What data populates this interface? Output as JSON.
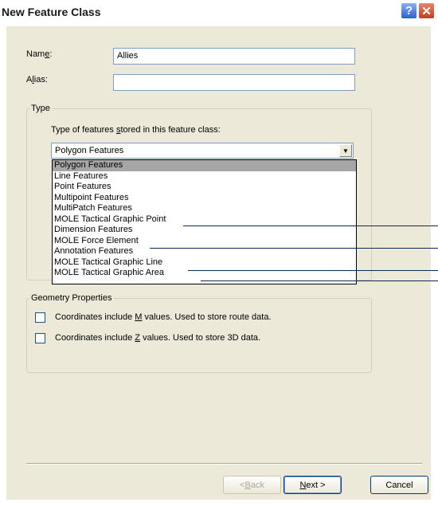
{
  "window": {
    "title": "New Feature Class"
  },
  "form": {
    "name_label_prefix": "Nam",
    "name_label_accel": "e",
    "name_label_suffix": ":",
    "name_value": "Allies",
    "alias_label_prefix": "A",
    "alias_label_accel": "l",
    "alias_label_suffix": "ias:",
    "alias_value": ""
  },
  "type_group": {
    "legend": "Type",
    "prompt_prefix": "Type of features ",
    "prompt_accel": "s",
    "prompt_suffix": "tored in this feature class:",
    "selected_value": "Polygon Features",
    "options": [
      "Polygon Features",
      "Line Features",
      "Point Features",
      "Multipoint Features",
      "MultiPatch Features",
      "MOLE Tactical Graphic Point",
      "Dimension Features",
      "MOLE Force Element",
      "Annotation Features",
      "MOLE Tactical Graphic Line",
      "MOLE Tactical Graphic Area"
    ]
  },
  "geometry_group": {
    "legend": "Geometry Properties",
    "m_prefix": "Coordinates include ",
    "m_accel": "M",
    "m_suffix": " values. Used to store route data.",
    "m_checked": false,
    "z_prefix": "Coordinates include ",
    "z_accel": "Z",
    "z_suffix": " values. Used to store 3D data.",
    "z_checked": false
  },
  "buttons": {
    "back_prefix": "< ",
    "back_accel": "B",
    "back_suffix": "ack",
    "next_accel": "N",
    "next_suffix": "ext >",
    "cancel": "Cancel"
  },
  "colors": {
    "dialog_face": "#ece9d8",
    "selection": "#a6a6a6",
    "pointer_line": "#0b2a5b"
  }
}
